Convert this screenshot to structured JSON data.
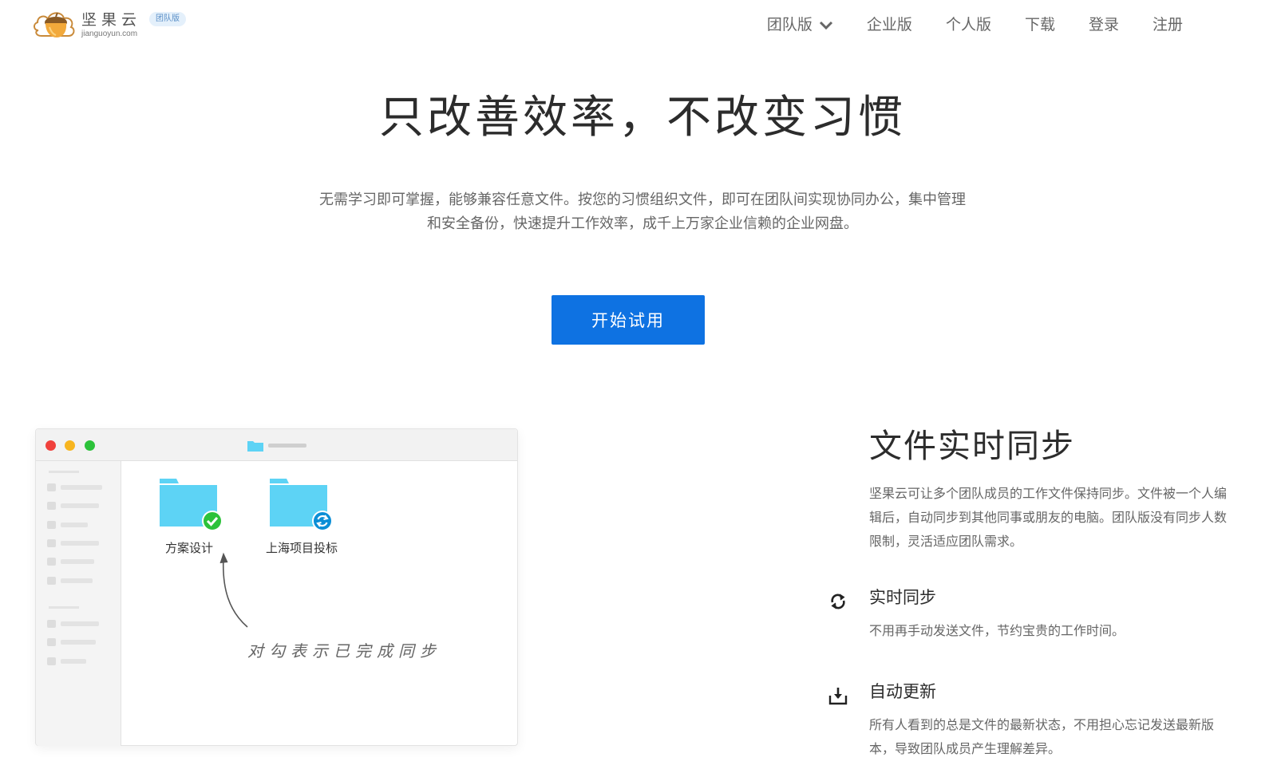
{
  "header": {
    "logo_name": "坚果云",
    "logo_domain": "jianguoyun.com",
    "logo_badge": "团队版",
    "nav": {
      "team": "团队版",
      "enterprise": "企业版",
      "personal": "个人版",
      "download": "下载",
      "login": "登录",
      "register": "注册"
    }
  },
  "hero": {
    "title": "只改善效率，不改变习惯",
    "desc_line1": "无需学习即可掌握，能够兼容任意文件。按您的习惯组织文件，即可在团队间实现协同办公，集中管理",
    "desc_line2": "和安全备份，快速提升工作效率，成千上万家企业信赖的企业网盘。",
    "cta": "开始试用"
  },
  "mock": {
    "folder1": "方案设计",
    "folder2": "上海项目投标",
    "annotation": "对勾表示已完成同步"
  },
  "feature": {
    "title": "文件实时同步",
    "desc": "坚果云可让多个团队成员的工作文件保持同步。文件被一个人编辑后，自动同步到其他同事或朋友的电脑。团队版没有同步人数限制，灵活适应团队需求。",
    "items": [
      {
        "icon": "sync-icon",
        "title": "实时同步",
        "desc": "不用再手动发送文件，节约宝贵的工作时间。"
      },
      {
        "icon": "download-tray-icon",
        "title": "自动更新",
        "desc": "所有人看到的总是文件的最新状态，不用担心忘记发送最新版本，导致团队成员产生理解差异。"
      }
    ]
  },
  "colors": {
    "accent": "#0e72e2",
    "folder": "#5dd3f5",
    "synced": "#2cc23a",
    "syncing": "#0b8ed6"
  }
}
